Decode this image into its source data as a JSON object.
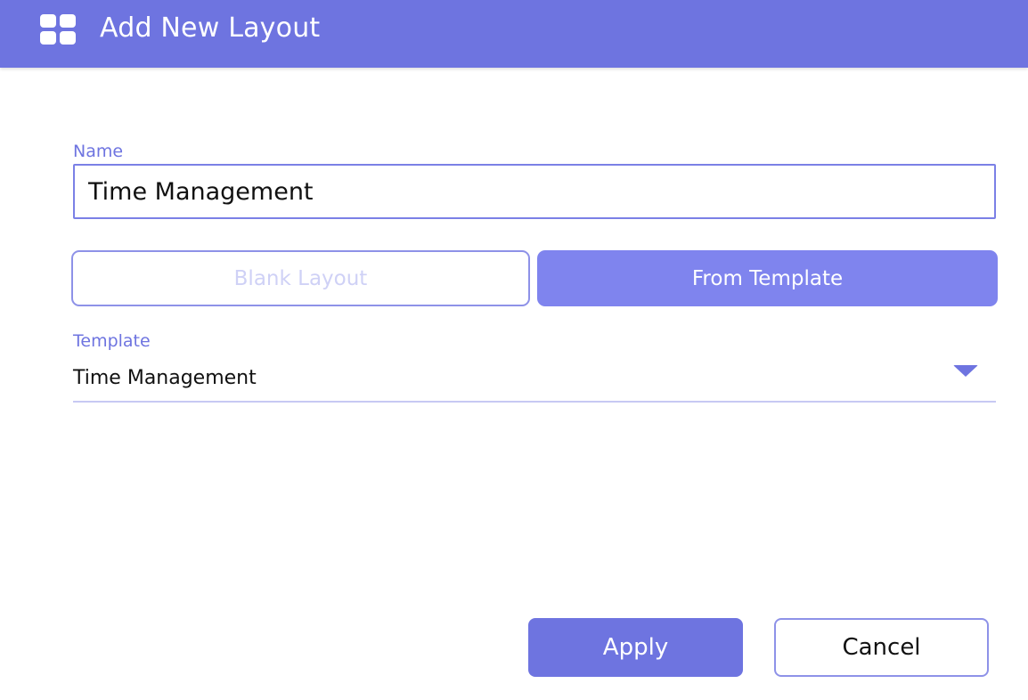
{
  "dialog": {
    "title": "Add New Layout",
    "title_icon": "layout-grid-icon"
  },
  "name_field": {
    "label": "Name",
    "value": "Time Management"
  },
  "mode": {
    "blank_label": "Blank Layout",
    "template_label": "From Template",
    "selected": "From Template"
  },
  "template_field": {
    "label": "Template",
    "value": "Time Management",
    "arrow_icon": "dropdown-arrow-icon"
  },
  "actions": {
    "apply_label": "Apply",
    "cancel_label": "Cancel"
  },
  "colors": {
    "accent": "#6e74e0",
    "accent_light": "#7f84ee",
    "disabled_text": "#cfd1f6"
  }
}
